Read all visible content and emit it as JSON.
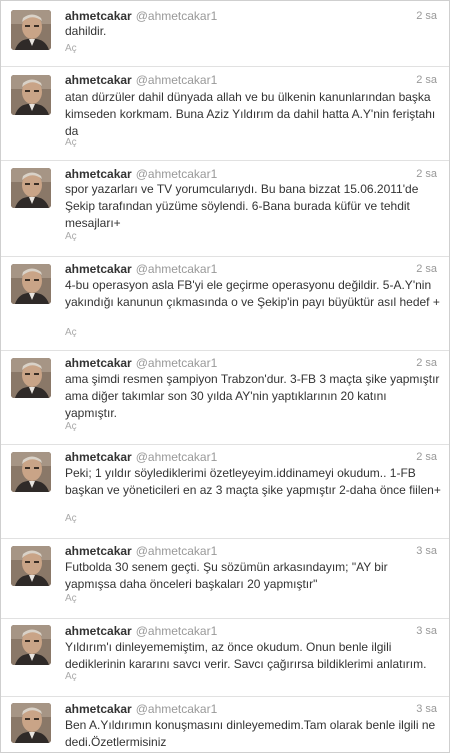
{
  "timeline": {
    "tweets": [
      {
        "name": "ahmetcakar",
        "handle": "@ahmetcakar1",
        "time": "2 sa",
        "text": "dahildir.",
        "action": "Aç"
      },
      {
        "name": "ahmetcakar",
        "handle": "@ahmetcakar1",
        "time": "2 sa",
        "text": "atan dürzüler dahil dünyada allah ve bu ülkenin kanunlarından başka kimseden korkmam. Buna Aziz Yıldırım da dahil hatta A.Y'nin feriştahı da",
        "action": "Aç"
      },
      {
        "name": "ahmetcakar",
        "handle": "@ahmetcakar1",
        "time": "2 sa",
        "text": "spor yazarları ve TV yorumcularıydı. Bu bana bizzat 15.06.2011'de Şekip tarafından yüzüme söylendi. 6-Bana burada küfür ve tehdit mesajları+",
        "action": "Aç"
      },
      {
        "name": "ahmetcakar",
        "handle": "@ahmetcakar1",
        "time": "2 sa",
        "text": "4-bu operasyon asla FB'yi ele geçirme operasyonu değildir. 5-A.Y'nin yakındığı kanunun çıkmasında o ve Şekip'in payı büyüktür asıl hedef +",
        "action": "Aç"
      },
      {
        "name": "ahmetcakar",
        "handle": "@ahmetcakar1",
        "time": "2 sa",
        "text": "ama şimdi resmen şampiyon Trabzon'dur. 3-FB 3 maçta şike yapmıştır ama diğer takımlar son 30 yılda AY'nin yaptıklarının 20 katını yapmıştır.",
        "action": "Aç"
      },
      {
        "name": "ahmetcakar",
        "handle": "@ahmetcakar1",
        "time": "2 sa",
        "text": "Peki; 1 yıldır söylediklerimi özetleyeyim.iddinameyi okudum.. 1-FB başkan ve yöneticileri en az 3 maçta şike yapmıştır 2-daha önce fiilen+",
        "action": "Aç"
      },
      {
        "name": "ahmetcakar",
        "handle": "@ahmetcakar1",
        "time": "3 sa",
        "text": "Futbolda 30 senem geçti. Şu sözümün arkasındayım; \"AY bir yapmışsa daha önceleri başkaları 20 yapmıştır\"",
        "action": "Aç"
      },
      {
        "name": "ahmetcakar",
        "handle": "@ahmetcakar1",
        "time": "3 sa",
        "text": "Yıldırım'ı dinleyememiştim, az önce okudum. Onun benle ilgili dediklerinin kararını savcı verir. Savcı çağırırsa bildiklerimi anlatırım.",
        "action": "Aç"
      },
      {
        "name": "ahmetcakar",
        "handle": "@ahmetcakar1",
        "time": "3 sa",
        "text": "Ben A.Yıldırımın konuşmasını dinleyemedim.Tam olarak benle ilgili ne dedi.Özetlermisiniz",
        "action": ""
      }
    ]
  },
  "colors": {
    "name": "#333333",
    "meta": "#999999",
    "divider": "#e1e1e1"
  },
  "icons": {
    "avatar": "profile-photo"
  }
}
